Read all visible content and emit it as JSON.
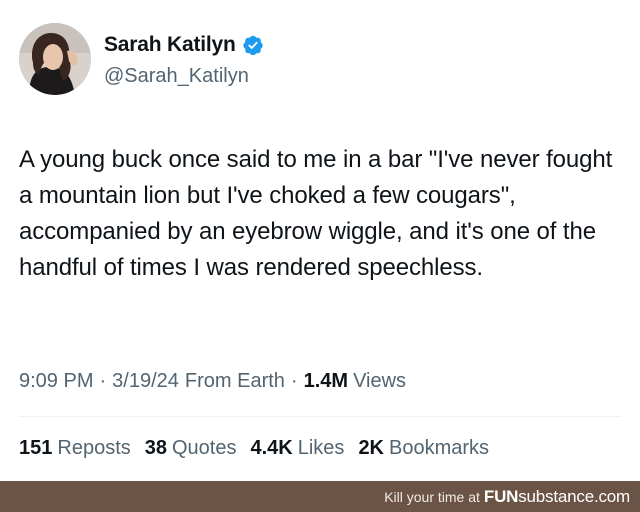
{
  "tweet": {
    "author": {
      "display_name": "Sarah Katilyn",
      "handle": "@Sarah_Katilyn",
      "verified_color": "#1d9bf0"
    },
    "text": "A young buck once said to me in a bar \"I've never fought a mountain lion but I've choked a few cougars\", accompanied by an eyebrow wiggle, and it's one of the handful of times I was rendered speechless.",
    "meta": {
      "time": "9:09 PM",
      "separator": "·",
      "date": "3/19/24",
      "source": "From Earth",
      "views_count": "1.4M",
      "views_label": "Views"
    },
    "stats": {
      "reposts_count": "151",
      "reposts_label": "Reposts",
      "quotes_count": "38",
      "quotes_label": "Quotes",
      "likes_count": "4.4K",
      "likes_label": "Likes",
      "bookmarks_count": "2K",
      "bookmarks_label": "Bookmarks"
    }
  },
  "watermark": {
    "prefix": "Kill your time at",
    "brand_bold": "FUN",
    "brand_light": "substance",
    "brand_suffix": ".com"
  }
}
